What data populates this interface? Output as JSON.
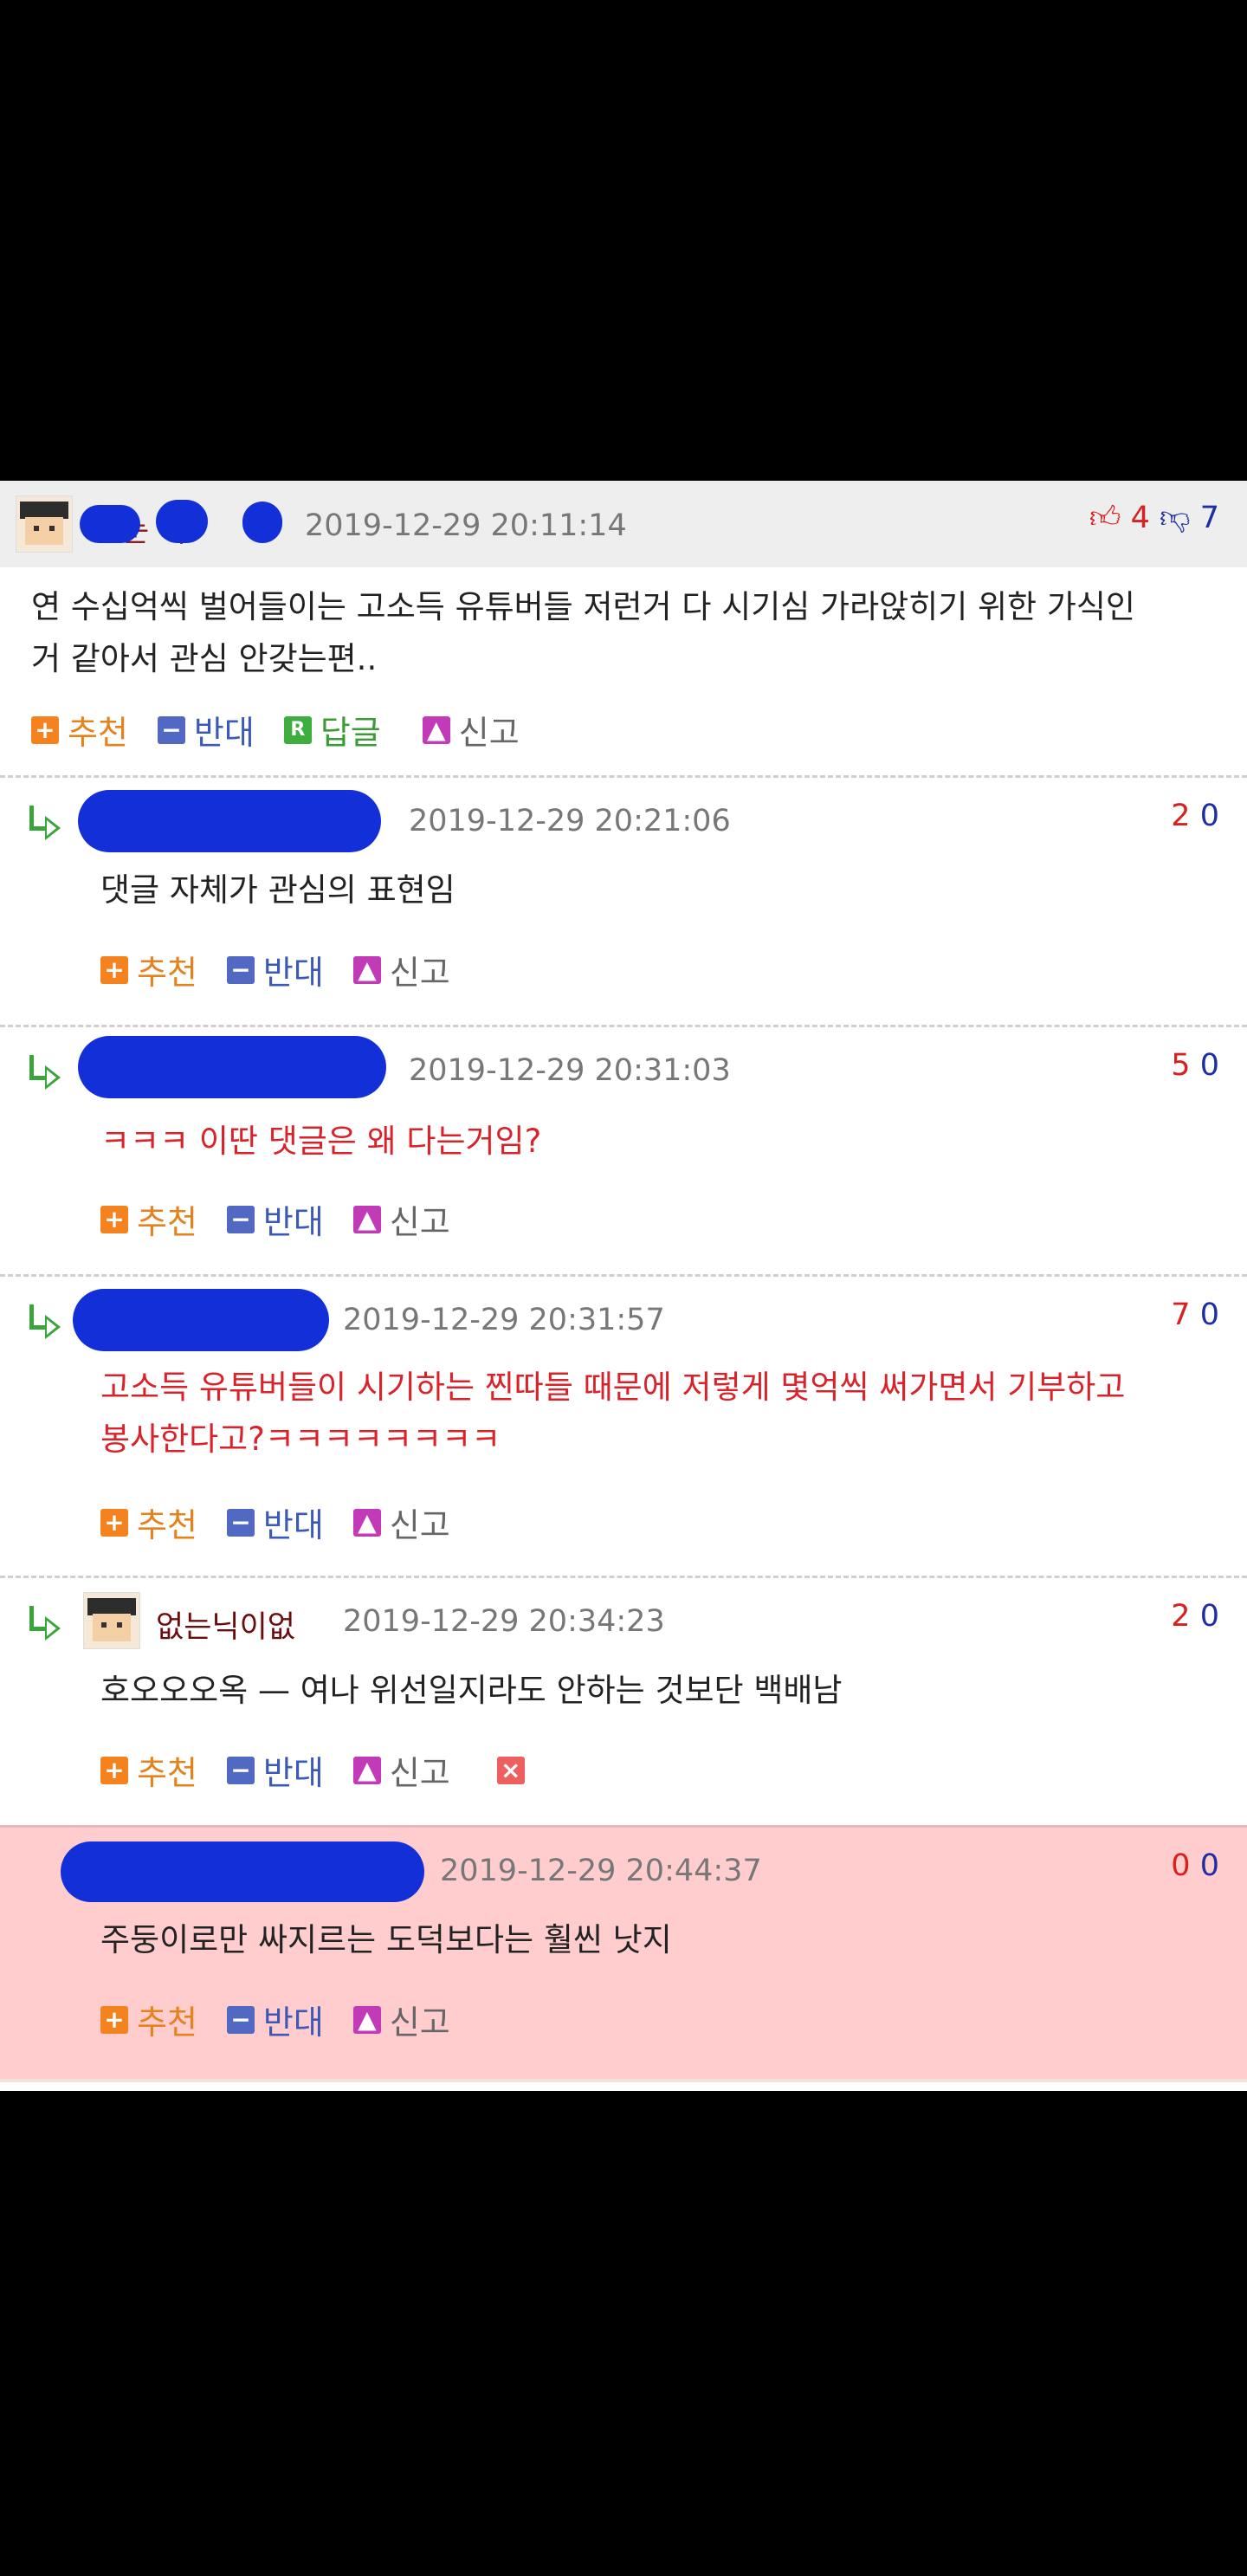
{
  "main_comment": {
    "username": "눈 미",
    "time": "2019-12-29 20:11:14",
    "up_count": "4",
    "down_count": "7",
    "text_line1": "연 수십억씩 벌어들이는 고소득 유튜버들 저런거 다 시기심 가라앉히기 위한 가식인",
    "text_line2": "거 같아서 관심 안갖는편..",
    "actions": {
      "recommend": "추천",
      "oppose": "반대",
      "reply": "답글",
      "report": "신고"
    }
  },
  "replies": [
    {
      "time": "2019-12-29 20:21:06",
      "up": "2",
      "down": "0",
      "text": "댓글 자체가 관심의 표현임",
      "red": false
    },
    {
      "time": "2019-12-29 20:31:03",
      "up": "5",
      "down": "0",
      "text": "ㅋㅋㅋ 이딴 댓글은 왜 다는거임?",
      "red": true
    },
    {
      "time": "2019-12-29 20:31:57",
      "up": "7",
      "down": "0",
      "text": "고소득 유튜버들이 시기하는 찐따들 때문에 저렇게 몇억씩 써가면서 기부하고",
      "text2": "봉사한다고?ㅋㅋㅋㅋㅋㅋㅋㅋ",
      "red": true
    },
    {
      "username": "없는닉이없",
      "time": "2019-12-29 20:34:23",
      "up": "2",
      "down": "0",
      "text": "호오오오옥 — 여나 위선일지라도 안하는 것보단 백배남",
      "red": false
    },
    {
      "time": "2019-12-29 20:44:37",
      "up": "0",
      "down": "0",
      "text": "주둥이로만 싸지르는 도덕보다는 훨씬 낫지",
      "red": false
    }
  ],
  "reply_actions": {
    "recommend": "추천",
    "oppose": "반대",
    "report": "신고"
  },
  "colors": {
    "pink_highlight": "#ffcdcd",
    "recommend": "#f4821f",
    "oppose": "#5269c4"
  }
}
